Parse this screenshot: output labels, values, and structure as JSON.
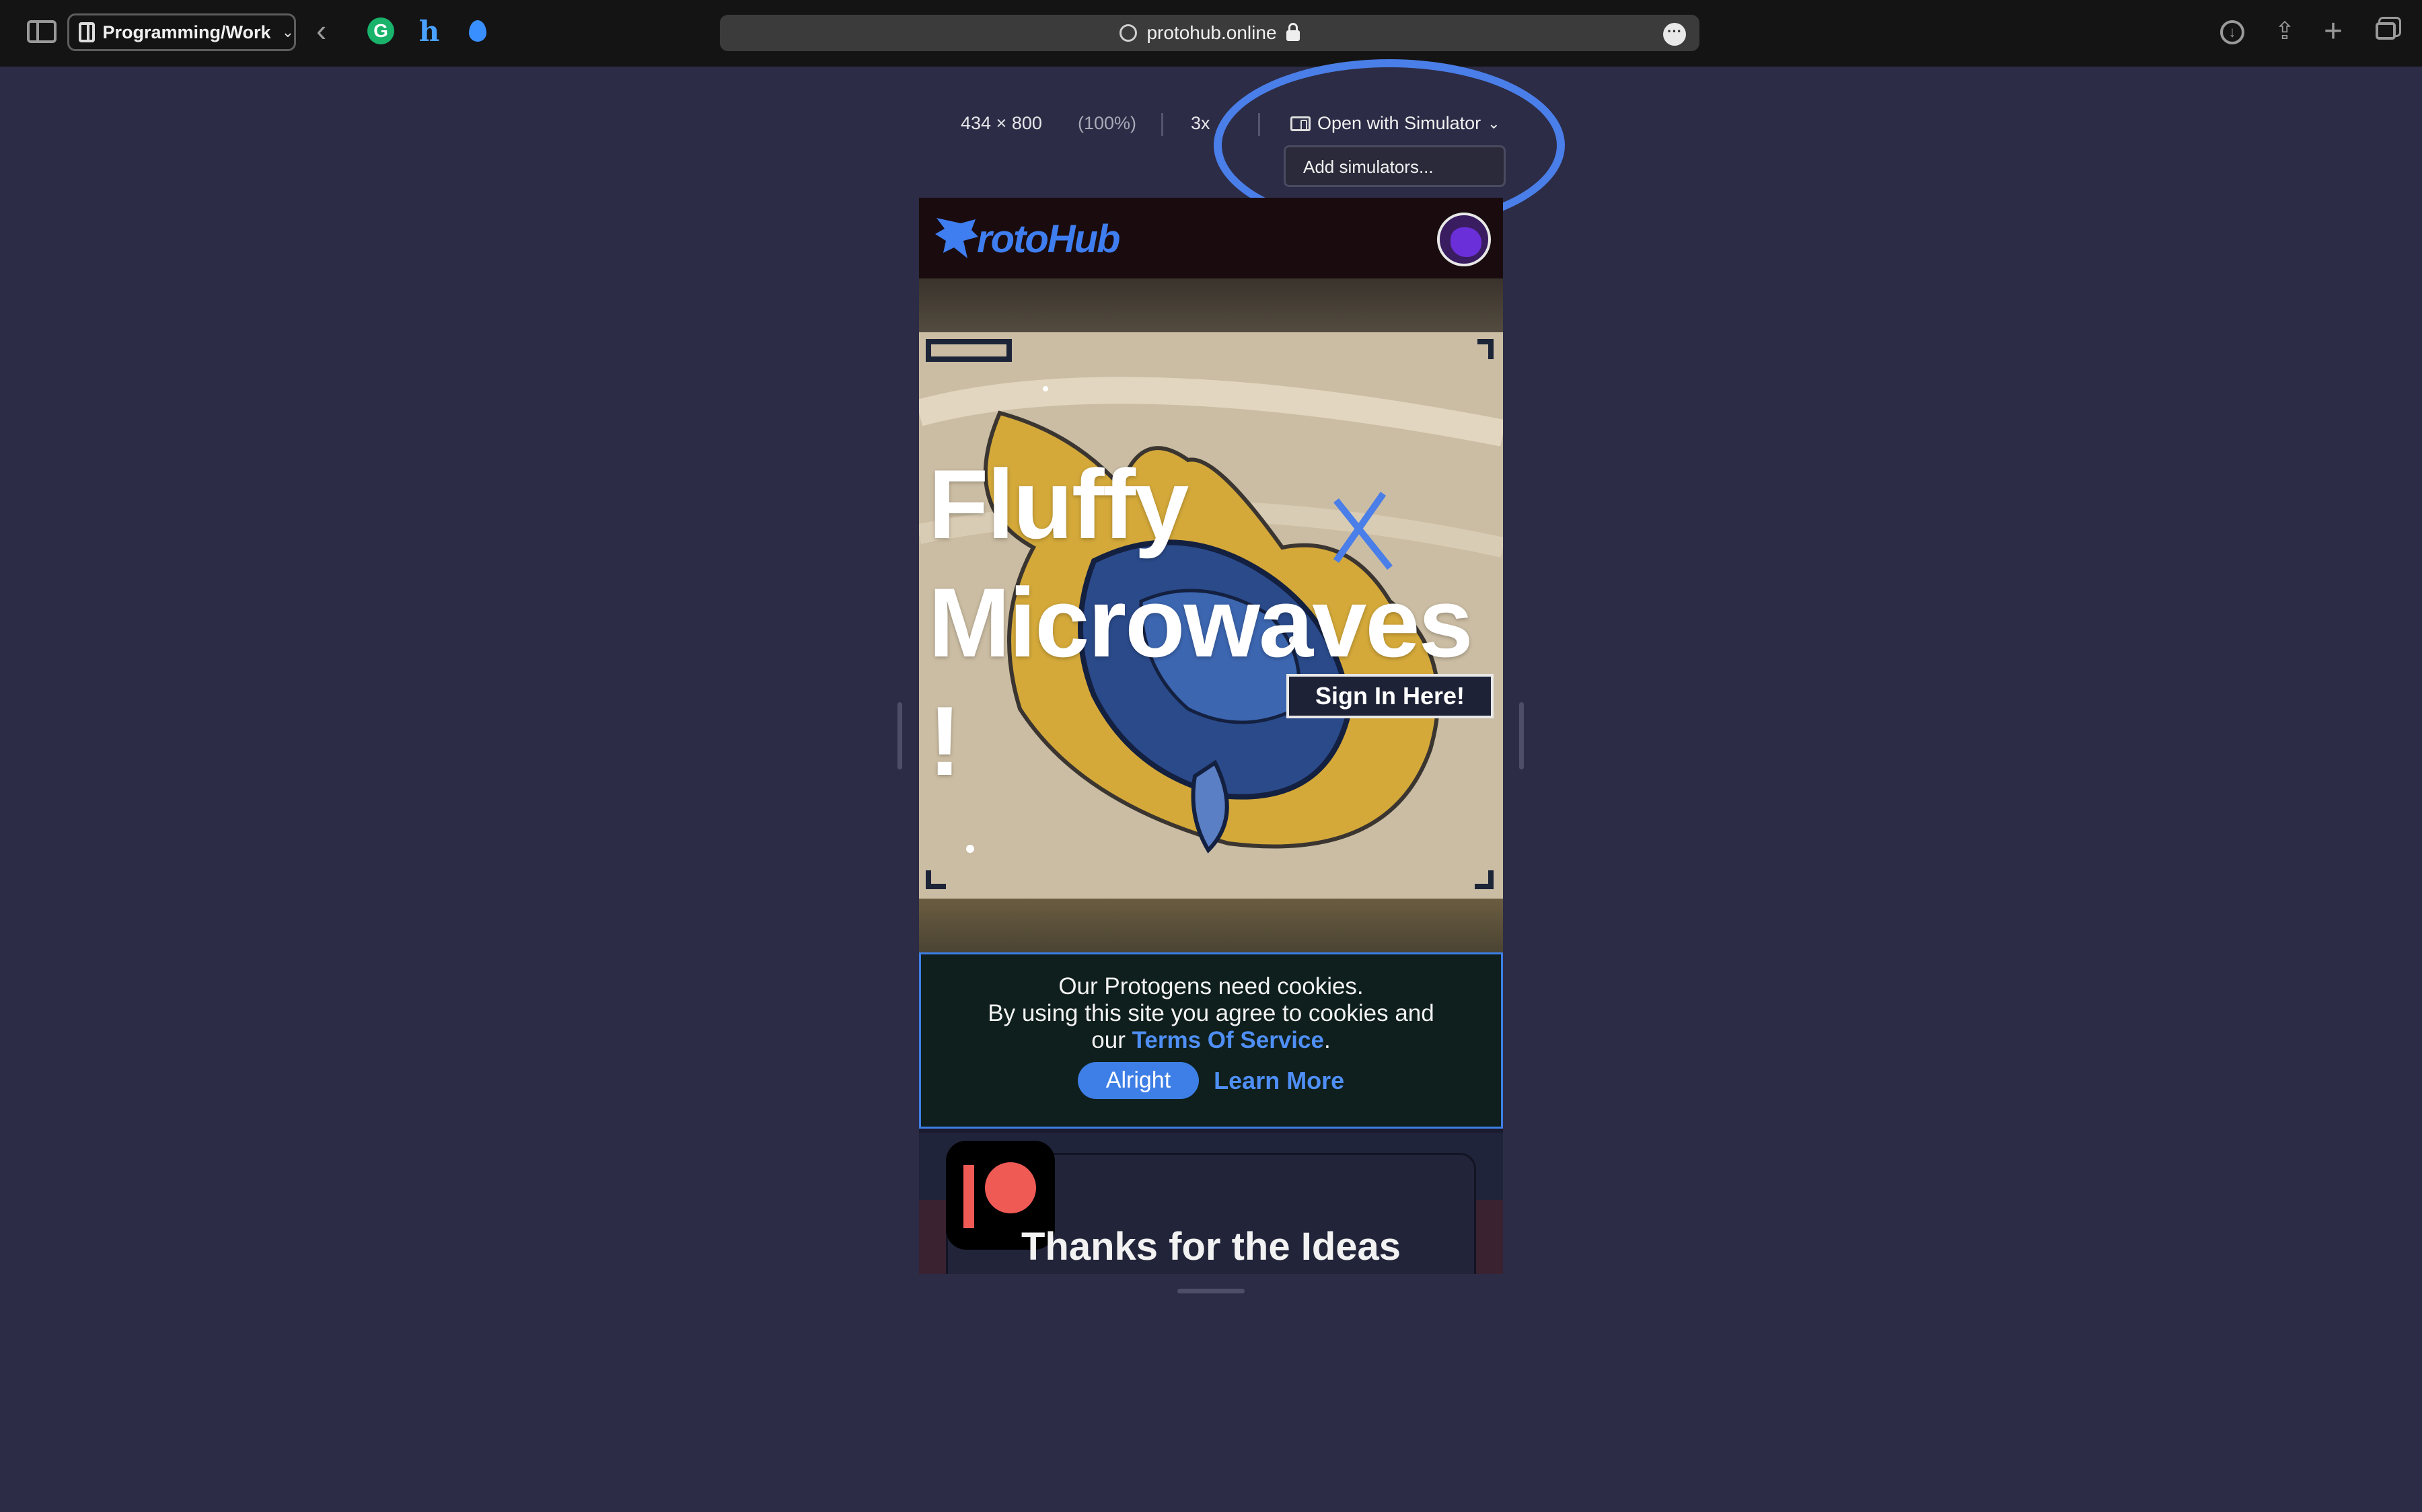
{
  "browser": {
    "tab_group": "Programming/Work",
    "address": "protohub.online",
    "extensions": [
      {
        "name": "grammarly-icon",
        "glyph": "G"
      },
      {
        "name": "honey-icon",
        "glyph": "h"
      },
      {
        "name": "raindrop-icon",
        "glyph": ""
      }
    ]
  },
  "responsive_bar": {
    "dimensions": "434 × 800",
    "zoom": "(100%)",
    "scale": "3x",
    "simulator_label": "Open with Simulator",
    "simulator_menu_item": "Add simulators..."
  },
  "site": {
    "logo_text": "rotoHub",
    "hero_title_line1": "Fluffy",
    "hero_title_line2": "Microwaves",
    "hero_title_line3": "!",
    "sign_in_label": "Sign In Here!",
    "cookie": {
      "line1": "Our Protogens need cookies.",
      "line2": "By using this site you agree to cookies and",
      "line3_prefix": "our ",
      "tos_link": "Terms Of Service",
      "line3_suffix": ".",
      "alright_label": "Alright",
      "learn_more_label": "Learn More"
    },
    "card_title": "Thanks for the Ideas"
  },
  "colors": {
    "accent": "#3d7fe6",
    "background": "#2c2c46",
    "patreon": "#f05a55"
  }
}
